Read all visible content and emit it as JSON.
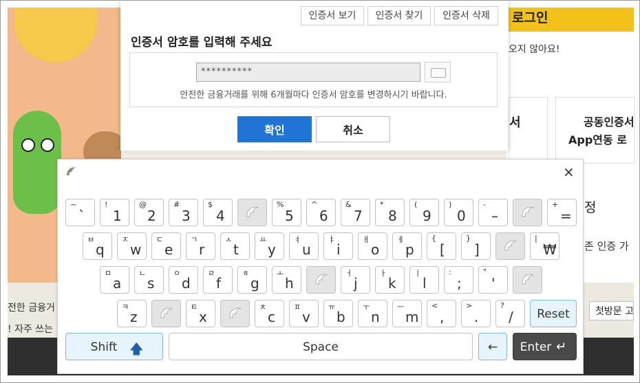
{
  "background": {
    "login_header": "로그인",
    "notice_text": "오지 않아요!",
    "box_left_label": "서",
    "box_right_line1": "공동인증서",
    "box_right_line2": "App연동 로",
    "side_label": "정",
    "side_auth": "존 인증 가",
    "band_text1": "전한 금융거",
    "band_text2": "! 자주 쓰는",
    "first_visit_button": "첫방문 고"
  },
  "dialog": {
    "btn_view": "인증서 보기",
    "btn_find": "인증서 찾기",
    "btn_delete": "인증서 삭제",
    "title": "인증서 암호를 입력해 주세요",
    "password_value": "**********",
    "hint": "안전한 금융거래를 위해 6개월마다 인증서 암호를 변경하시기 바랍니다.",
    "ok": "확인",
    "cancel": "취소"
  },
  "keyboard": {
    "close_symbol": "×",
    "rows": [
      [
        {
          "s": "~",
          "m": "`"
        },
        {
          "s": "!",
          "m": "1"
        },
        {
          "s": "@",
          "m": "2"
        },
        {
          "s": "#",
          "m": "3"
        },
        {
          "s": "$",
          "m": "4"
        },
        {
          "blank": true
        },
        {
          "s": "%",
          "m": "5"
        },
        {
          "s": "^",
          "m": "6"
        },
        {
          "s": "&",
          "m": "7"
        },
        {
          "s": "*",
          "m": "8"
        },
        {
          "s": "(",
          "m": "9"
        },
        {
          "s": ")",
          "m": "0"
        },
        {
          "s": "-",
          "m": "–"
        },
        {
          "blank": true
        },
        {
          "s": "+",
          "m": "="
        }
      ],
      [
        {
          "s": "ㅂ",
          "m": "q"
        },
        {
          "s": "ㅈ",
          "m": "w"
        },
        {
          "s": "ㄷ",
          "m": "e"
        },
        {
          "s": "ㄱ",
          "m": "r"
        },
        {
          "s": "ㅅ",
          "m": "t"
        },
        {
          "s": "ㅛ",
          "m": "y"
        },
        {
          "s": "ㅕ",
          "m": "u"
        },
        {
          "s": "ㅑ",
          "m": "i"
        },
        {
          "s": "ㅐ",
          "m": "o"
        },
        {
          "s": "ㅔ",
          "m": "p"
        },
        {
          "s": "{",
          "m": "["
        },
        {
          "s": "}",
          "m": "]"
        },
        {
          "blank": true
        },
        {
          "s": "|",
          "m": "₩"
        }
      ],
      [
        {
          "s": "ㅁ",
          "m": "a"
        },
        {
          "s": "ㄴ",
          "m": "s"
        },
        {
          "s": "ㅇ",
          "m": "d"
        },
        {
          "s": "ㄹ",
          "m": "f"
        },
        {
          "s": "ㅎ",
          "m": "g"
        },
        {
          "s": "ㅗ",
          "m": "h"
        },
        {
          "blank": true
        },
        {
          "s": "ㅓ",
          "m": "j"
        },
        {
          "s": "ㅏ",
          "m": "k"
        },
        {
          "s": "ㅣ",
          "m": "l"
        },
        {
          "s": ":",
          "m": ";"
        },
        {
          "s": "\"",
          "m": "'"
        },
        {
          "blank": true
        }
      ],
      [
        {
          "s": "ㅋ",
          "m": "z"
        },
        {
          "blank": true
        },
        {
          "s": "ㅌ",
          "m": "x"
        },
        {
          "blank": true
        },
        {
          "s": "ㅊ",
          "m": "c"
        },
        {
          "s": "ㅍ",
          "m": "v"
        },
        {
          "s": "ㅠ",
          "m": "b"
        },
        {
          "s": "ㅜ",
          "m": "n"
        },
        {
          "s": "ㅡ",
          "m": "m"
        },
        {
          "s": "<",
          "m": ","
        },
        {
          "s": ">",
          "m": "."
        },
        {
          "s": "?",
          "m": "/"
        }
      ]
    ],
    "reset": "Reset",
    "shift": "Shift",
    "space": "Space",
    "backspace": "←",
    "enter": "Enter"
  }
}
